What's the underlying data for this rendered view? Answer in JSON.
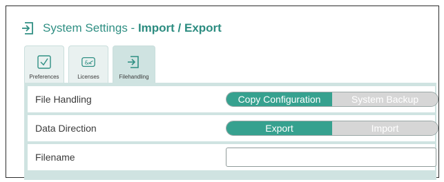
{
  "header": {
    "title_prefix": "System Settings",
    "title_sep": " - ",
    "title_section": "Import / Export",
    "icon": "import-icon"
  },
  "tabs": [
    {
      "label": "Preferences",
      "icon": "checkbox-icon",
      "active": false
    },
    {
      "label": "Licenses",
      "icon": "license-icon",
      "active": false
    },
    {
      "label": "Filehandling",
      "icon": "import-icon",
      "active": true
    }
  ],
  "rows": {
    "file_handling": {
      "label": "File Handling",
      "options": [
        "Copy Configuration",
        "System Backup"
      ],
      "selected": "Copy Configuration"
    },
    "data_direction": {
      "label": "Data Direction",
      "options": [
        "Export",
        "Import"
      ],
      "selected": "Export"
    },
    "filename": {
      "label": "Filename",
      "value": ""
    }
  },
  "colors": {
    "accent": "#36a18f",
    "title": "#2f8f83",
    "tab_bg": "#e9f1f0",
    "tab_active_bg": "#cfe3e1",
    "toggle_off": "#d6d6d6"
  }
}
